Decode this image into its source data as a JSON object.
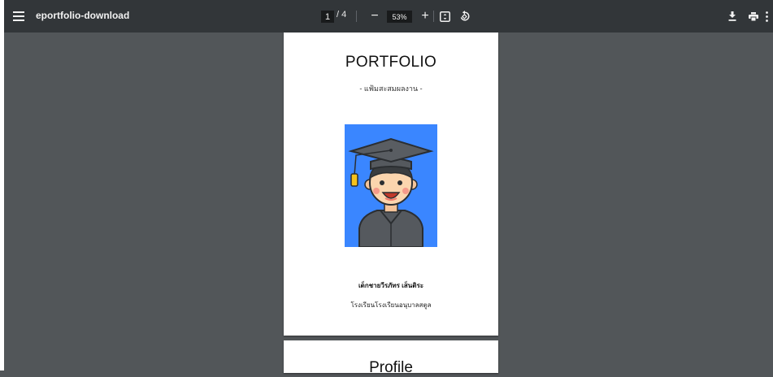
{
  "toolbar": {
    "document_title": "eportfolio-download",
    "current_page": "1",
    "page_total": "/ 4",
    "zoom_level": "53%",
    "zoom_out_symbol": "−",
    "zoom_in_symbol": "+",
    "icons": {
      "menu": "menu-icon",
      "zoom_out": "minus-icon",
      "zoom_in": "plus-icon",
      "fit": "fit-to-page-icon",
      "rotate": "rotate-icon",
      "download": "download-icon",
      "print": "print-icon",
      "more": "more-vertical-icon"
    },
    "colors": {
      "background": "#323639",
      "input_background": "#191b1c",
      "text": "#f1f1f1"
    }
  },
  "viewer": {
    "background_color": "#525659"
  },
  "page1": {
    "title": "PORTFOLIO",
    "subtitle": "- แฟ้มสะสมผลงาน -",
    "avatar_background_color": "#3a86ff",
    "student_name": "เด็กชายวีรภัทร  เส็นติระ",
    "school_name": "โรงเรียนโรงเรียนอนุบาลสตูล"
  },
  "page2": {
    "title": "Profile"
  }
}
